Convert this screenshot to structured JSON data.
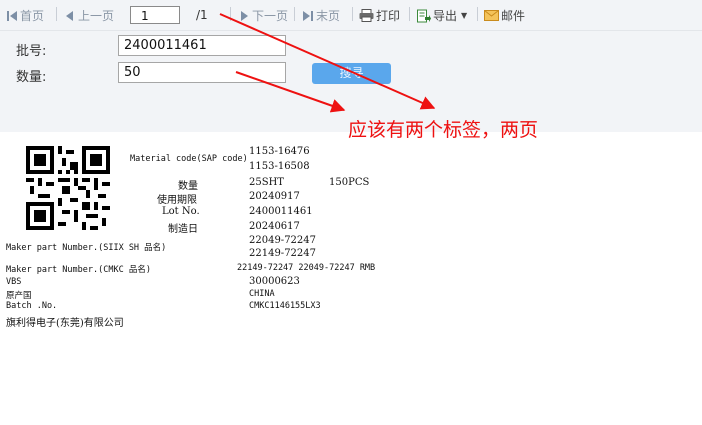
{
  "toolbar": {
    "first": "首页",
    "prev": "上一页",
    "page_input": "1",
    "page_total": "/1",
    "next": "下一页",
    "last": "末页",
    "print": "打印",
    "export": "导出",
    "mail": "邮件"
  },
  "form": {
    "batch_label": "批号:",
    "batch_value": "2400011461",
    "qty_label": "数量:",
    "qty_value": "50",
    "query_button": "搜寻"
  },
  "annotation": {
    "text": "应该有两个标签，两页",
    "color": "#ee1111"
  },
  "label": {
    "material_code_label": "Material code(SAP code)",
    "material_code_1": "1153-16476",
    "material_code_2": "1153-16508",
    "qty_label": "数量",
    "qty_value": "25SHT",
    "pcs_value": "150PCS",
    "expiry_label": "使用期限",
    "expiry_value": "20240917",
    "lot_label": "Lot No.",
    "lot_value": "2400011461",
    "mfg_label": "制造日",
    "mfg_value": "20240617",
    "maker_siix_label": "Maker part Number.(SIIX SH 品名)",
    "maker_siix_value_1": "22049-72247",
    "maker_siix_value_2": "22149-72247",
    "maker_cmkc_label": "Maker part Number.(CMKC 品名)",
    "maker_cmkc_value": "22149-72247 22049-72247 RMB",
    "vbs_label": "VBS",
    "vbs_value": "30000623",
    "origin_label": "原产国",
    "origin_value": "CHINA",
    "batch_label": "Batch .No.",
    "batch_value": "CMKC1146155LX3",
    "company": "旗利得电子(东莞)有限公司"
  },
  "colors": {
    "toolbar_bg": "#f2f4f7",
    "button_blue": "#5aa7ec",
    "annotation_red": "#ee1111"
  }
}
